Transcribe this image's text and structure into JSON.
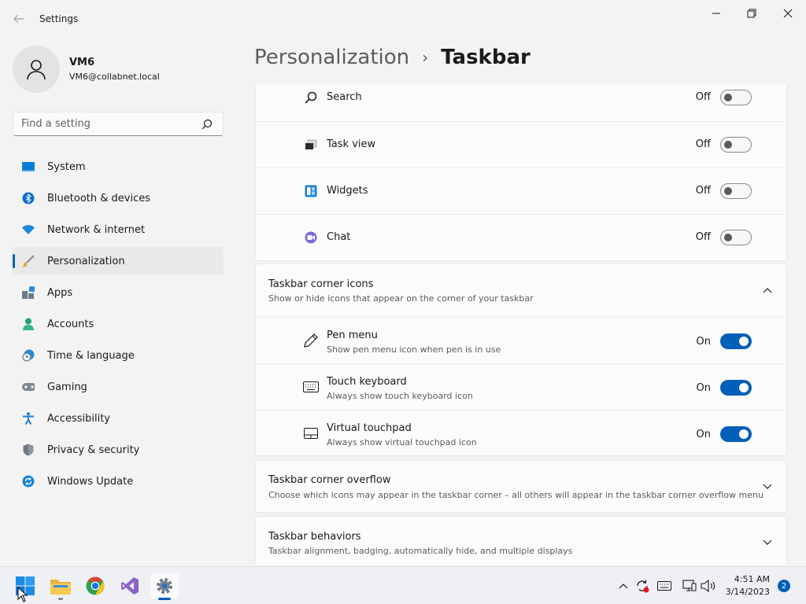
{
  "app": {
    "title": "Settings"
  },
  "profile": {
    "name": "VM6",
    "email": "VM6@collabnet.local"
  },
  "search": {
    "placeholder": "Find a setting"
  },
  "sidebar": {
    "items": [
      {
        "label": "System",
        "icon": "system-icon"
      },
      {
        "label": "Bluetooth & devices",
        "icon": "bluetooth-icon"
      },
      {
        "label": "Network & internet",
        "icon": "wifi-icon"
      },
      {
        "label": "Personalization",
        "icon": "brush-icon",
        "active": true
      },
      {
        "label": "Apps",
        "icon": "apps-icon"
      },
      {
        "label": "Accounts",
        "icon": "accounts-icon"
      },
      {
        "label": "Time & language",
        "icon": "clock-globe-icon"
      },
      {
        "label": "Gaming",
        "icon": "gamepad-icon"
      },
      {
        "label": "Accessibility",
        "icon": "accessibility-icon"
      },
      {
        "label": "Privacy & security",
        "icon": "shield-icon"
      },
      {
        "label": "Windows Update",
        "icon": "update-icon"
      }
    ]
  },
  "breadcrumb": {
    "parent": "Personalization",
    "separator": "›",
    "current": "Taskbar"
  },
  "taskbar_items": [
    {
      "label": "Search",
      "state": "Off",
      "icon": "search-icon"
    },
    {
      "label": "Task view",
      "state": "Off",
      "icon": "task-view-icon"
    },
    {
      "label": "Widgets",
      "state": "Off",
      "icon": "widgets-icon"
    },
    {
      "label": "Chat",
      "state": "Off",
      "icon": "chat-icon"
    }
  ],
  "corner_icons": {
    "title": "Taskbar corner icons",
    "subtitle": "Show or hide icons that appear on the corner of your taskbar",
    "items": [
      {
        "label": "Pen menu",
        "sub": "Show pen menu icon when pen is in use",
        "state": "On",
        "icon": "pen-icon"
      },
      {
        "label": "Touch keyboard",
        "sub": "Always show touch keyboard icon",
        "state": "On",
        "icon": "keyboard-icon"
      },
      {
        "label": "Virtual touchpad",
        "sub": "Always show virtual touchpad icon",
        "state": "On",
        "icon": "touchpad-icon"
      }
    ]
  },
  "corner_overflow": {
    "title": "Taskbar corner overflow",
    "subtitle": "Choose which icons may appear in the taskbar corner – all others will appear in the taskbar corner overflow menu"
  },
  "behaviors": {
    "title": "Taskbar behaviors",
    "subtitle": "Taskbar alignment, badging, automatically hide, and multiple displays"
  },
  "clock": {
    "time": "4:51 AM",
    "date": "3/14/2023"
  },
  "notifications": {
    "count": "2"
  },
  "colors": {
    "accent": "#005fb8",
    "background": "#f3f3f3",
    "card": "#fbfbfb"
  }
}
